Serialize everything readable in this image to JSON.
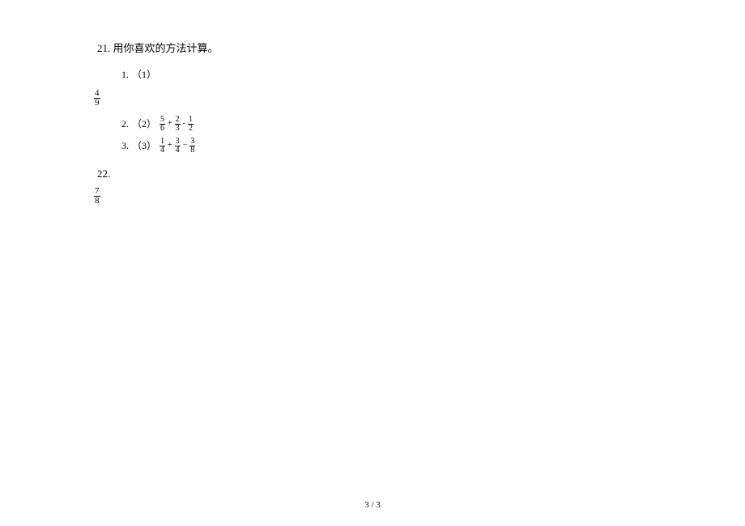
{
  "q21": {
    "number": "21.",
    "title": "用你喜欢的方法计算。",
    "items": {
      "i1": {
        "num": "1.",
        "label": "（1）"
      },
      "frac_isolated_1": {
        "num": "4",
        "den": "9"
      },
      "i2": {
        "num": "2.",
        "label": "（2）",
        "expr": {
          "f1": {
            "num": "5",
            "den": "6"
          },
          "op1": "+",
          "f2": {
            "num": "2",
            "den": "3"
          },
          "op2": "-",
          "f3": {
            "num": "1",
            "den": "2"
          }
        }
      },
      "i3": {
        "num": "3.",
        "label": "（3）",
        "expr": {
          "f1": {
            "num": "1",
            "den": "4"
          },
          "op1": "+",
          "f2": {
            "num": "3",
            "den": "4"
          },
          "op2": "−",
          "f3": {
            "num": "3",
            "den": "8"
          }
        }
      }
    }
  },
  "q22": {
    "number": "22.",
    "frac": {
      "num": "7",
      "den": "8"
    }
  },
  "page_number": "3 / 3"
}
